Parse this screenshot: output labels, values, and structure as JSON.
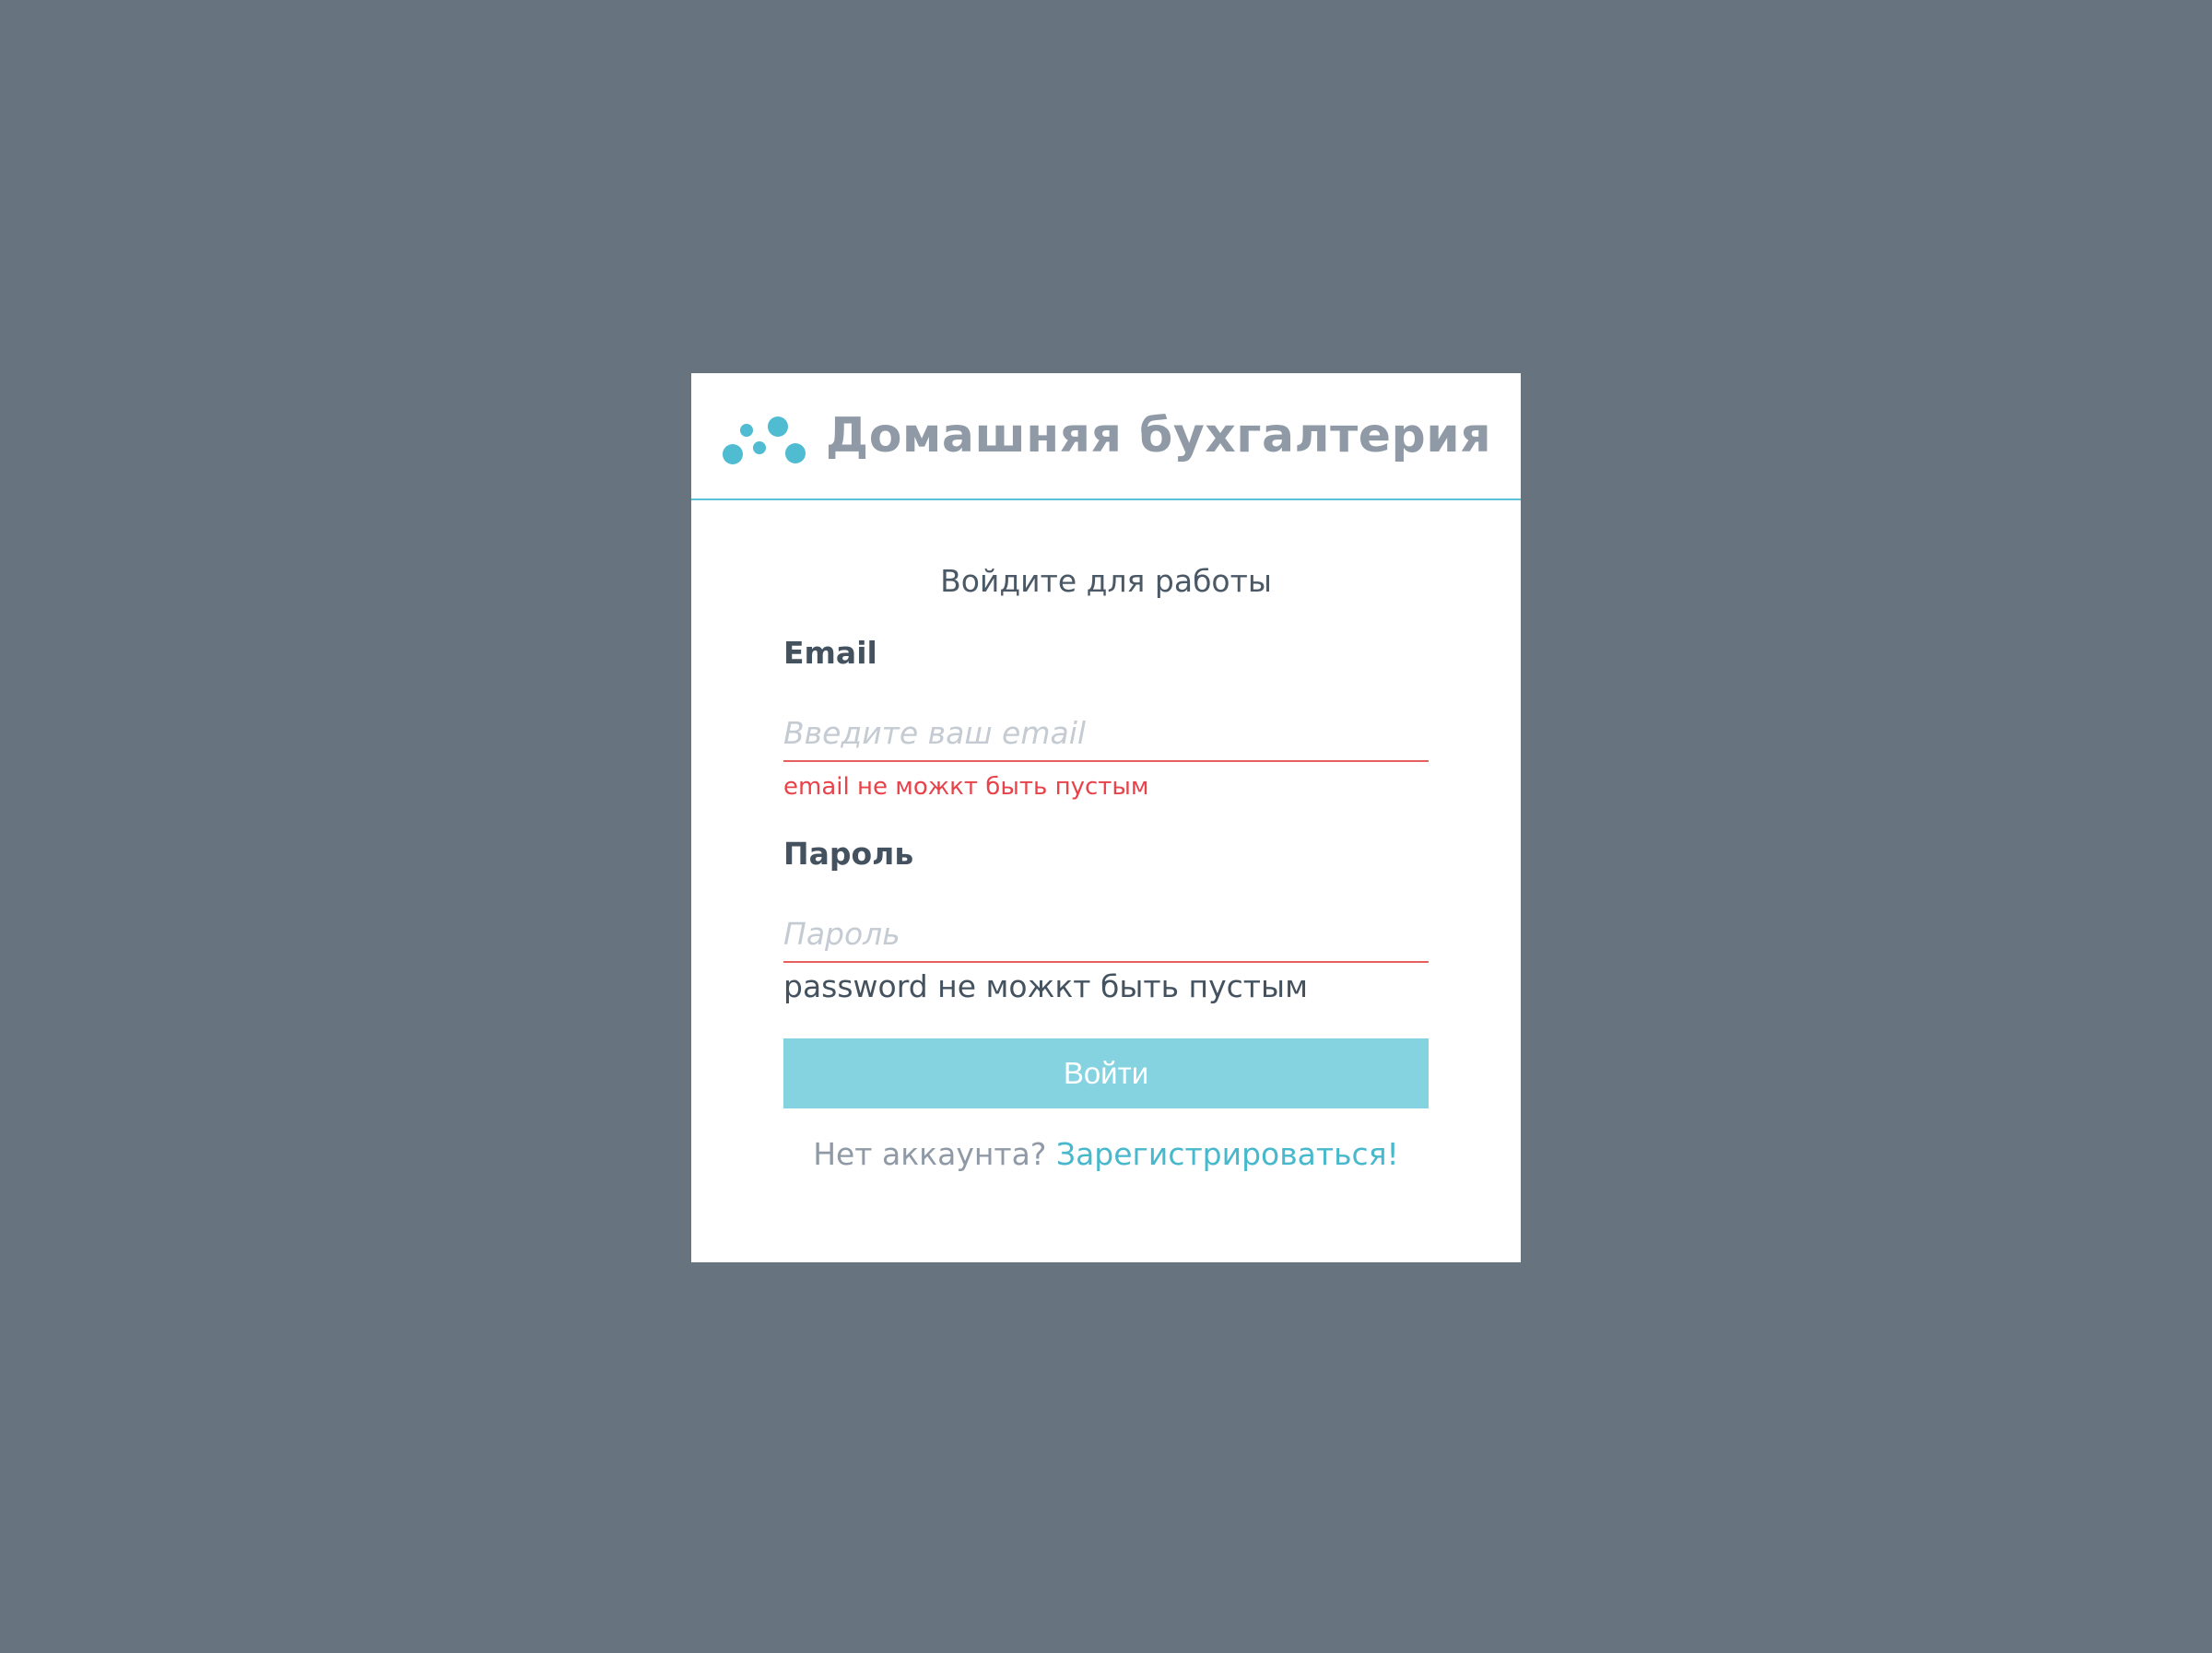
{
  "app": {
    "title": "Домашняя бухгалтерия",
    "logo_icon": "dots-logo-icon"
  },
  "login": {
    "subtitle": "Войдите для работы",
    "email": {
      "label": "Email",
      "value": "",
      "placeholder": "Введите ваш email",
      "error": "email не можкт быть пустым"
    },
    "password": {
      "label": "Пароль",
      "value": "",
      "placeholder": "Пароль",
      "error": "password не можкт быть пустым"
    },
    "submit_label": "Войти",
    "register_prompt": "Нет аккаунта?",
    "register_link": "Зарегистрироваться!"
  },
  "colors": {
    "background": "#67747f",
    "accent": "#5bc3d3",
    "button": "#85d2e0",
    "error": "#e8434a",
    "error_underline": "#e8605e",
    "link": "#48b8cc"
  }
}
